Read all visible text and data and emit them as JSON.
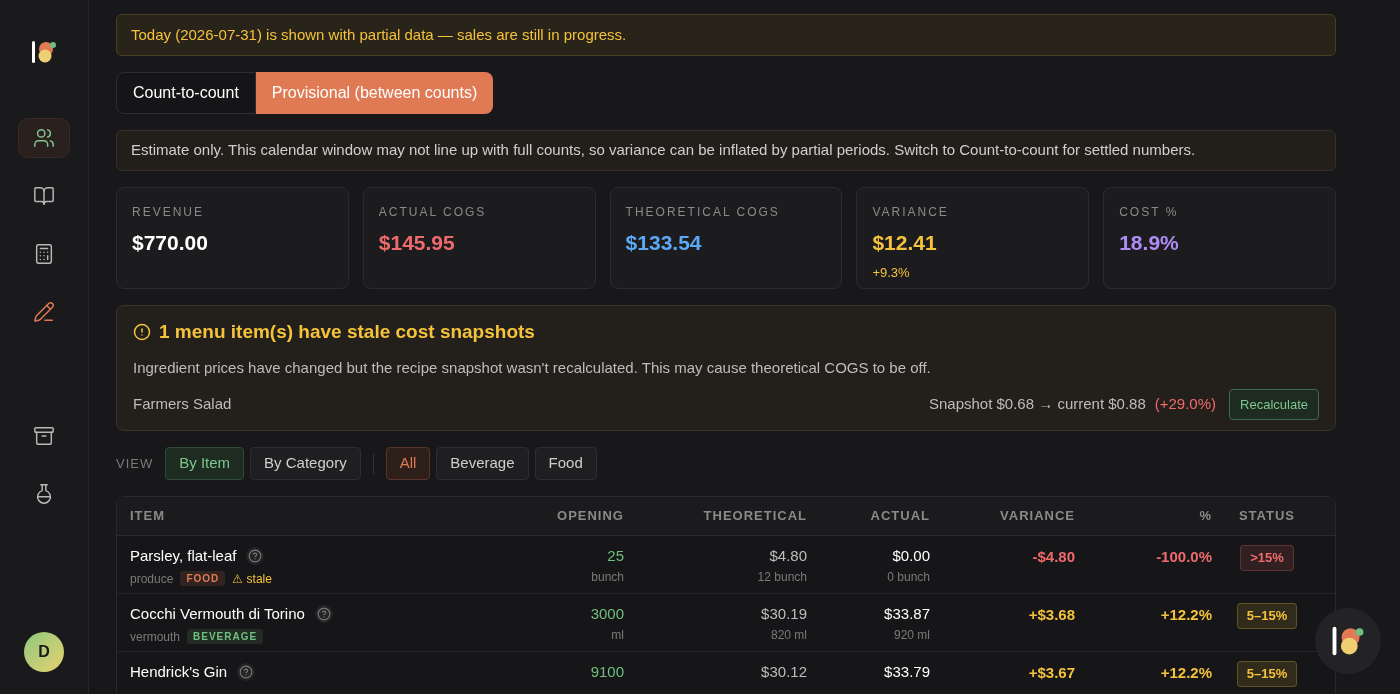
{
  "sidebar": {
    "items": [
      {
        "kind": "users",
        "selected": true
      },
      {
        "kind": "book",
        "selected": false
      },
      {
        "kind": "calculator",
        "selected": false
      },
      {
        "kind": "pencil",
        "selected": false
      },
      {
        "kind": "archive",
        "selected": false
      },
      {
        "kind": "flask",
        "selected": false
      }
    ],
    "avatar": "D"
  },
  "notice": "Today (2026-07-31) is shown with partial data — sales are still in progress.",
  "mode_tabs": [
    {
      "label": "Count-to-count",
      "selected": false
    },
    {
      "label": "Provisional (between counts)",
      "selected": true
    }
  ],
  "estimate_note": "Estimate only. This calendar window may not line up with full counts, so variance can be inflated by partial periods. Switch to Count-to-count for settled numbers.",
  "stats": [
    {
      "label": "REVENUE",
      "value": "$770.00",
      "color": "#ffffff"
    },
    {
      "label": "ACTUAL COGS",
      "value": "$145.95",
      "color": "#ef6b6b"
    },
    {
      "label": "THEORETICAL COGS",
      "value": "$133.54",
      "color": "#5ba8f5"
    },
    {
      "label": "VARIANCE",
      "value": "$12.41",
      "color": "#f5c23b",
      "sub": "+9.3%"
    },
    {
      "label": "COST %",
      "value": "18.9%",
      "color": "#b08cf8"
    }
  ],
  "stale_alert": {
    "title": "1 menu item(s) have stale cost snapshots",
    "description": "Ingredient prices have changed but the recipe snapshot wasn't recalculated. This may cause theoretical COGS to be off.",
    "items": [
      {
        "name": "Farmers Salad",
        "change": "Snapshot $0.68 → current $0.88",
        "delta": "(+29.0%)",
        "button": "Recalculate"
      }
    ]
  },
  "view": {
    "label": "VIEW",
    "modes": [
      {
        "label": "By Item",
        "selected": true
      },
      {
        "label": "By Category",
        "selected": false
      }
    ],
    "filters": [
      {
        "label": "All",
        "selected": true
      },
      {
        "label": "Beverage",
        "selected": false
      },
      {
        "label": "Food",
        "selected": false
      }
    ]
  },
  "table": {
    "columns": [
      "ITEM",
      "OPENING",
      "THEORETICAL",
      "ACTUAL",
      "VARIANCE",
      "%",
      "STATUS"
    ],
    "rows": [
      {
        "name": "Parsley, flat-leaf",
        "subcategory": "produce",
        "tag": {
          "text": "FOOD",
          "color": "#e07a55"
        },
        "stale": "⚠ stale",
        "opening": "25",
        "opening_unit": "bunch",
        "theoretical": "$4.80",
        "theoretical_qty": "12 bunch",
        "actual": "$0.00",
        "actual_qty": "0 bunch",
        "variance": "-$4.80",
        "percent": "-100.0%",
        "status": {
          "text": ">15%",
          "color": "#ef6b6b"
        }
      },
      {
        "name": "Cocchi Vermouth di Torino",
        "subcategory": "vermouth",
        "tag": {
          "text": "BEVERAGE",
          "color": "#6fbf7f"
        },
        "opening": "3000",
        "opening_unit": "ml",
        "theoretical": "$30.19",
        "theoretical_qty": "820 ml",
        "actual": "$33.87",
        "actual_qty": "920 ml",
        "variance": "+$3.68",
        "percent": "+12.2%",
        "status": {
          "text": "5–15%",
          "color": "#f5c23b"
        }
      },
      {
        "name": "Hendrick's Gin",
        "opening": "9100",
        "theoretical": "$30.12",
        "actual": "$33.79",
        "variance": "+$3.67",
        "percent": "+12.2%",
        "status": {
          "text": "5–15%",
          "color": "#f5c23b"
        }
      }
    ]
  }
}
